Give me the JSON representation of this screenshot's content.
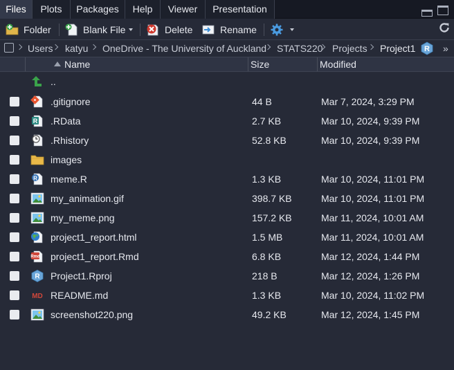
{
  "tabs": [
    {
      "label": "Files",
      "active": true
    },
    {
      "label": "Plots",
      "active": false
    },
    {
      "label": "Packages",
      "active": false
    },
    {
      "label": "Help",
      "active": false
    },
    {
      "label": "Viewer",
      "active": false
    },
    {
      "label": "Presentation",
      "active": false
    }
  ],
  "toolbar": {
    "new_folder_label": "Folder",
    "blank_file_label": "Blank File",
    "delete_label": "Delete",
    "rename_label": "Rename"
  },
  "breadcrumb": [
    "Users",
    "katyu",
    "OneDrive - The University of Auckland",
    "STATS220",
    "Projects",
    "Project1"
  ],
  "breadcrumb_more": "»",
  "table": {
    "columns": [
      "Name",
      "Size",
      "Modified"
    ],
    "parent_label": "..",
    "rows": [
      {
        "name": ".gitignore",
        "size": "44 B",
        "modified": "Mar 7, 2024, 3:29 PM",
        "icon": "git-icon"
      },
      {
        "name": ".RData",
        "size": "2.7 KB",
        "modified": "Mar 10, 2024, 9:39 PM",
        "icon": "rdata-icon"
      },
      {
        "name": ".Rhistory",
        "size": "52.8 KB",
        "modified": "Mar 10, 2024, 9:39 PM",
        "icon": "history-icon"
      },
      {
        "name": "images",
        "size": "",
        "modified": "",
        "icon": "folder-icon"
      },
      {
        "name": "meme.R",
        "size": "1.3 KB",
        "modified": "Mar 10, 2024, 11:01 PM",
        "icon": "r-script-icon"
      },
      {
        "name": "my_animation.gif",
        "size": "398.7 KB",
        "modified": "Mar 10, 2024, 11:01 PM",
        "icon": "image-icon"
      },
      {
        "name": "my_meme.png",
        "size": "157.2 KB",
        "modified": "Mar 11, 2024, 10:01 AM",
        "icon": "image-icon"
      },
      {
        "name": "project1_report.html",
        "size": "1.5 MB",
        "modified": "Mar 11, 2024, 10:01 AM",
        "icon": "html-globe-icon"
      },
      {
        "name": "project1_report.Rmd",
        "size": "6.8 KB",
        "modified": "Mar 12, 2024, 1:44 PM",
        "icon": "rmd-icon"
      },
      {
        "name": "Project1.Rproj",
        "size": "218 B",
        "modified": "Mar 12, 2024, 1:26 PM",
        "icon": "rproj-icon"
      },
      {
        "name": "README.md",
        "size": "1.3 KB",
        "modified": "Mar 10, 2024, 11:02 PM",
        "icon": "markdown-icon"
      },
      {
        "name": "screenshot220.png",
        "size": "49.2 KB",
        "modified": "Mar 12, 2024, 1:45 PM",
        "icon": "image-icon"
      }
    ]
  },
  "colors": {
    "background": "#262a37",
    "tabbar": "#161923",
    "header": "#2f3444",
    "text": "#e6e8ee",
    "accent_blue": "#3d8fd6"
  }
}
